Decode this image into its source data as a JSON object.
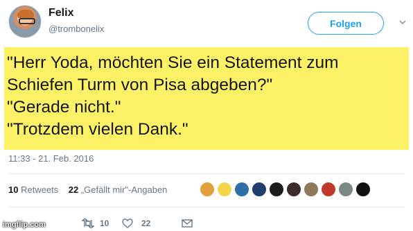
{
  "user": {
    "name": "Felix",
    "handle": "@trombonelix"
  },
  "follow_button": {
    "label": "Folgen"
  },
  "tweet": {
    "lines": [
      "\"Herr Yoda, möchten Sie ein Statement zum",
      "Schiefen Turm von Pisa abgeben?\"",
      "\"Gerade nicht.\"",
      "\"Trotzdem vielen Dank.\""
    ],
    "highlight_color": "#fdf265"
  },
  "timestamp": "11:33 - 21. Feb. 2016",
  "stats": {
    "retweets_count": "10",
    "retweets_label": "Retweets",
    "likes_count": "22",
    "likes_label": "„Gefällt mir\"-Angaben"
  },
  "likers": [
    {
      "icon": "avatar-yellow-bird",
      "color": "#e2a13b"
    },
    {
      "icon": "avatar-lightbulb",
      "color": "#f3d64a"
    },
    {
      "icon": "avatar-blue-pattern",
      "color": "#2e6fa8"
    },
    {
      "icon": "avatar-tennessee-titans",
      "color": "#1f3e6e"
    },
    {
      "icon": "avatar-dark-circle",
      "color": "#1d1d1d"
    },
    {
      "icon": "avatar-record",
      "color": "#3b2b2b"
    },
    {
      "icon": "avatar-photo-person",
      "color": "#8c7a5a"
    },
    {
      "icon": "avatar-red-shirt",
      "color": "#c0392b"
    },
    {
      "icon": "avatar-gray-landscape",
      "color": "#7a8a82"
    },
    {
      "icon": "avatar-black-logo",
      "color": "#111111"
    }
  ],
  "actions": {
    "retweet_count": "10",
    "like_count": "22"
  },
  "accent_color": "#1da1f2",
  "watermark": "imgflip.com"
}
